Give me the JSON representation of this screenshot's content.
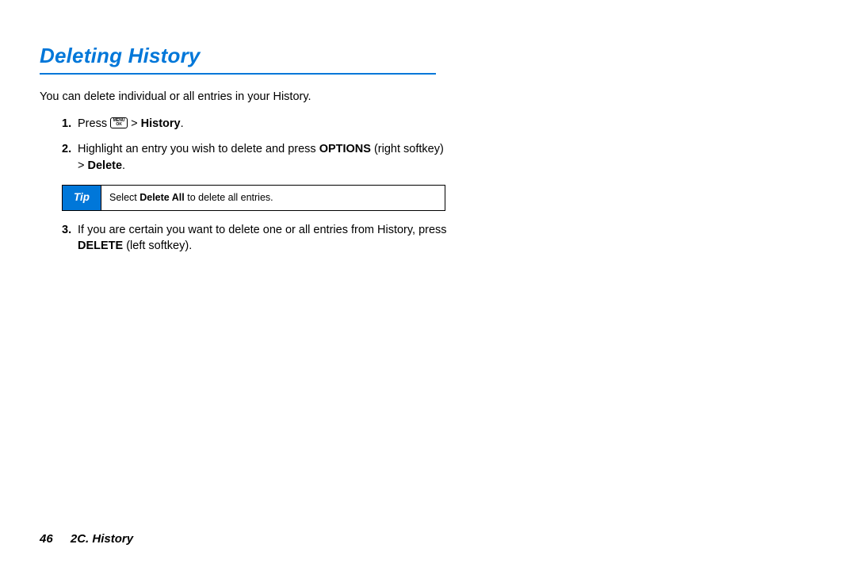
{
  "heading": "Deleting History",
  "intro": "You can delete individual or all entries in your History.",
  "steps": {
    "s1": {
      "num": "1.",
      "press": "Press ",
      "menu_top": "MENU",
      "menu_bot": "OK",
      "arrow": " > ",
      "history": "History",
      "period": "."
    },
    "s2": {
      "num": "2.",
      "a": "Highlight an entry you wish to delete and press ",
      "options": "OPTIONS",
      "b": " (right softkey) > ",
      "delete": "Delete",
      "c": "."
    },
    "s3": {
      "num": "3.",
      "a": "If you are certain you want to delete one or all entries from History, press ",
      "delete": "DELETE",
      "b": " (left softkey)."
    }
  },
  "tip": {
    "label": "Tip",
    "a": "Select ",
    "bold": "Delete All",
    "b": " to delete all entries."
  },
  "footer": {
    "page": "46",
    "section": "2C. History"
  }
}
